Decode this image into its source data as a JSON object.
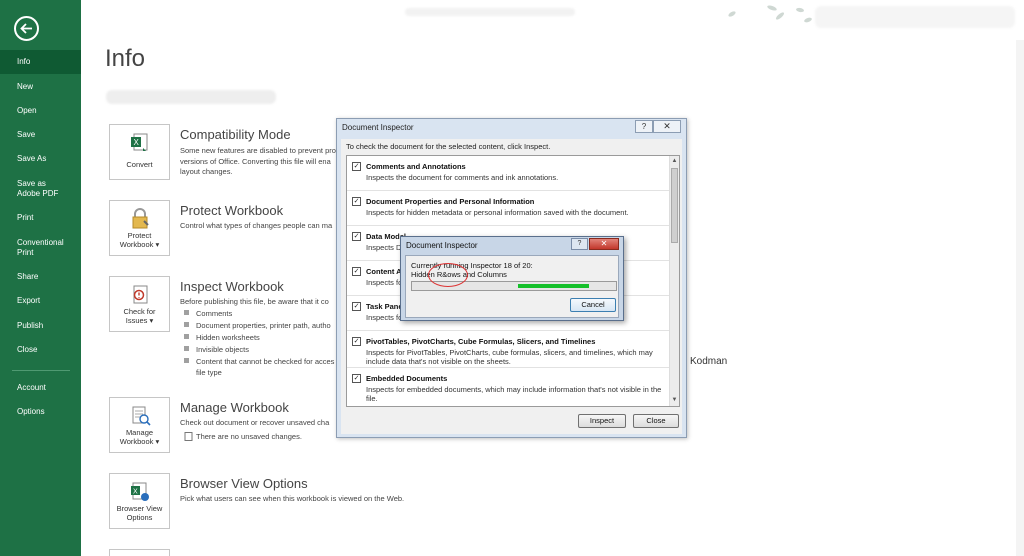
{
  "sidebar": {
    "items": [
      {
        "key": "info",
        "label": "Info",
        "active": true
      },
      {
        "key": "new",
        "label": "New"
      },
      {
        "key": "open",
        "label": "Open"
      },
      {
        "key": "save",
        "label": "Save"
      },
      {
        "key": "save-as",
        "label": "Save As"
      },
      {
        "key": "save-as-pdf",
        "label": "Save as Adobe PDF"
      },
      {
        "key": "print",
        "label": "Print"
      },
      {
        "key": "conventional-print",
        "label": "Conventional Print"
      },
      {
        "key": "share",
        "label": "Share"
      },
      {
        "key": "export",
        "label": "Export"
      },
      {
        "key": "publish",
        "label": "Publish"
      },
      {
        "key": "close",
        "label": "Close"
      },
      {
        "key": "account",
        "label": "Account"
      },
      {
        "key": "options",
        "label": "Options"
      }
    ]
  },
  "main": {
    "title": "Info",
    "owner": "Kodman",
    "sections": {
      "compat": {
        "tile": "Convert",
        "title": "Compatibility Mode",
        "lines": [
          "Some new features are disabled to prevent pro",
          "versions of Office. Converting this file will ena",
          "layout changes."
        ]
      },
      "protect": {
        "tile1": "Protect",
        "tile2": "Workbook ▾",
        "title": "Protect Workbook",
        "lines": [
          "Control what types of changes people can ma"
        ]
      },
      "inspect": {
        "tile1": "Check for",
        "tile2": "Issues ▾",
        "title": "Inspect Workbook",
        "lines": [
          "Before publishing this file, be aware that it co"
        ],
        "bullets": [
          "Comments",
          "Document properties, printer path, autho",
          "Hidden worksheets",
          "Invisible objects",
          "Content that cannot be checked for acces"
        ],
        "extra": "file type"
      },
      "manage": {
        "tile1": "Manage",
        "tile2": "Workbook ▾",
        "title": "Manage Workbook",
        "lines": [
          "Check out document or recover unsaved cha"
        ],
        "note": "There are no unsaved changes."
      },
      "browser": {
        "tile1": "Browser View",
        "tile2": "Options",
        "title": "Browser View Options",
        "lines": [
          "Pick what users can see when this workbook is viewed on the Web."
        ]
      }
    }
  },
  "dialog": {
    "title": "Document Inspector",
    "help": "?",
    "close": "✕",
    "instruction": "To check the document for the selected content, click Inspect.",
    "items": [
      {
        "title": "Comments and Annotations",
        "desc": "Inspects the document for comments and ink annotations."
      },
      {
        "title": "Document Properties and Personal Information",
        "desc": "Inspects for hidden metadata or personal information saved with the document."
      },
      {
        "title": "Data Model",
        "desc": "Inspects Da"
      },
      {
        "title": "Content Ad",
        "desc": "Inspects fo"
      },
      {
        "title": "Task Pane",
        "desc": "Inspects fo"
      },
      {
        "title": "PivotTables, PivotCharts, Cube Formulas, Slicers, and Timelines",
        "desc": "Inspects for PivotTables, PivotCharts, cube formulas, slicers, and timelines, which may include data that's not visible on the sheets."
      },
      {
        "title": "Embedded Documents",
        "desc": "Inspects for embedded documents, which may include information that's not visible in the file."
      }
    ],
    "inspect_label": "Inspect",
    "close_label": "Close"
  },
  "progress": {
    "title": "Document Inspector",
    "help": "?",
    "close": "✕",
    "line1": "Currently running Inspector 18 of 20:",
    "line2": "Hidden R&ows and Columns",
    "fill_start": 0.52,
    "fill_end": 0.87,
    "cancel_label": "Cancel"
  },
  "colors": {
    "sidebar": "#1e7145",
    "active": "#0f5a33",
    "progress": "#15c02a"
  }
}
